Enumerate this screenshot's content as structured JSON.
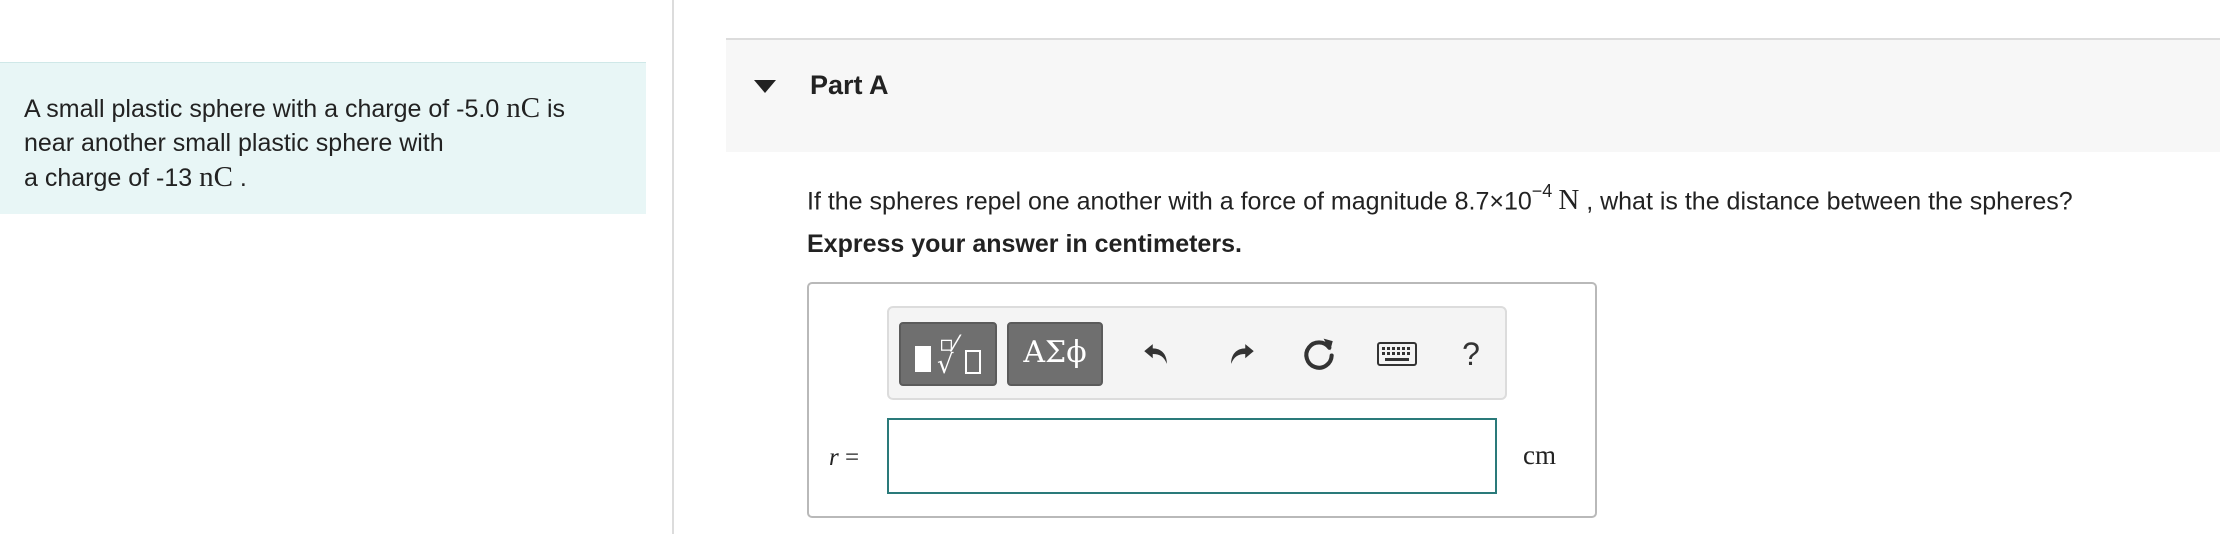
{
  "problem": {
    "line1_pre": "A small plastic sphere with a charge of -5.0 ",
    "line1_unit": "nC",
    "line1_post": " is",
    "line2": "near another small plastic sphere with",
    "line3_pre": "a charge of -13 ",
    "line3_unit": "nC",
    "line3_post": " ."
  },
  "part": {
    "title": "Part A"
  },
  "question": {
    "pre": "If the spheres repel one another with a force of magnitude 8.7×10",
    "exponent": "−4",
    "unit": "N",
    "post": " , what is the distance between the spheres?"
  },
  "instruction": "Express your answer in centimeters.",
  "toolbar": {
    "greek_label": "ΑΣϕ",
    "help_label": "?",
    "icons": [
      "templates-icon",
      "greek-symbols-icon",
      "undo-icon",
      "redo-icon",
      "reset-icon",
      "keyboard-icon",
      "help-icon"
    ]
  },
  "answer": {
    "variable": "r",
    "equals": " =",
    "value": "",
    "unit": "cm"
  },
  "colors": {
    "problem_bg": "#e8f6f6",
    "input_border": "#2a7a7a",
    "toolbar_button": "#6f6f6f"
  }
}
